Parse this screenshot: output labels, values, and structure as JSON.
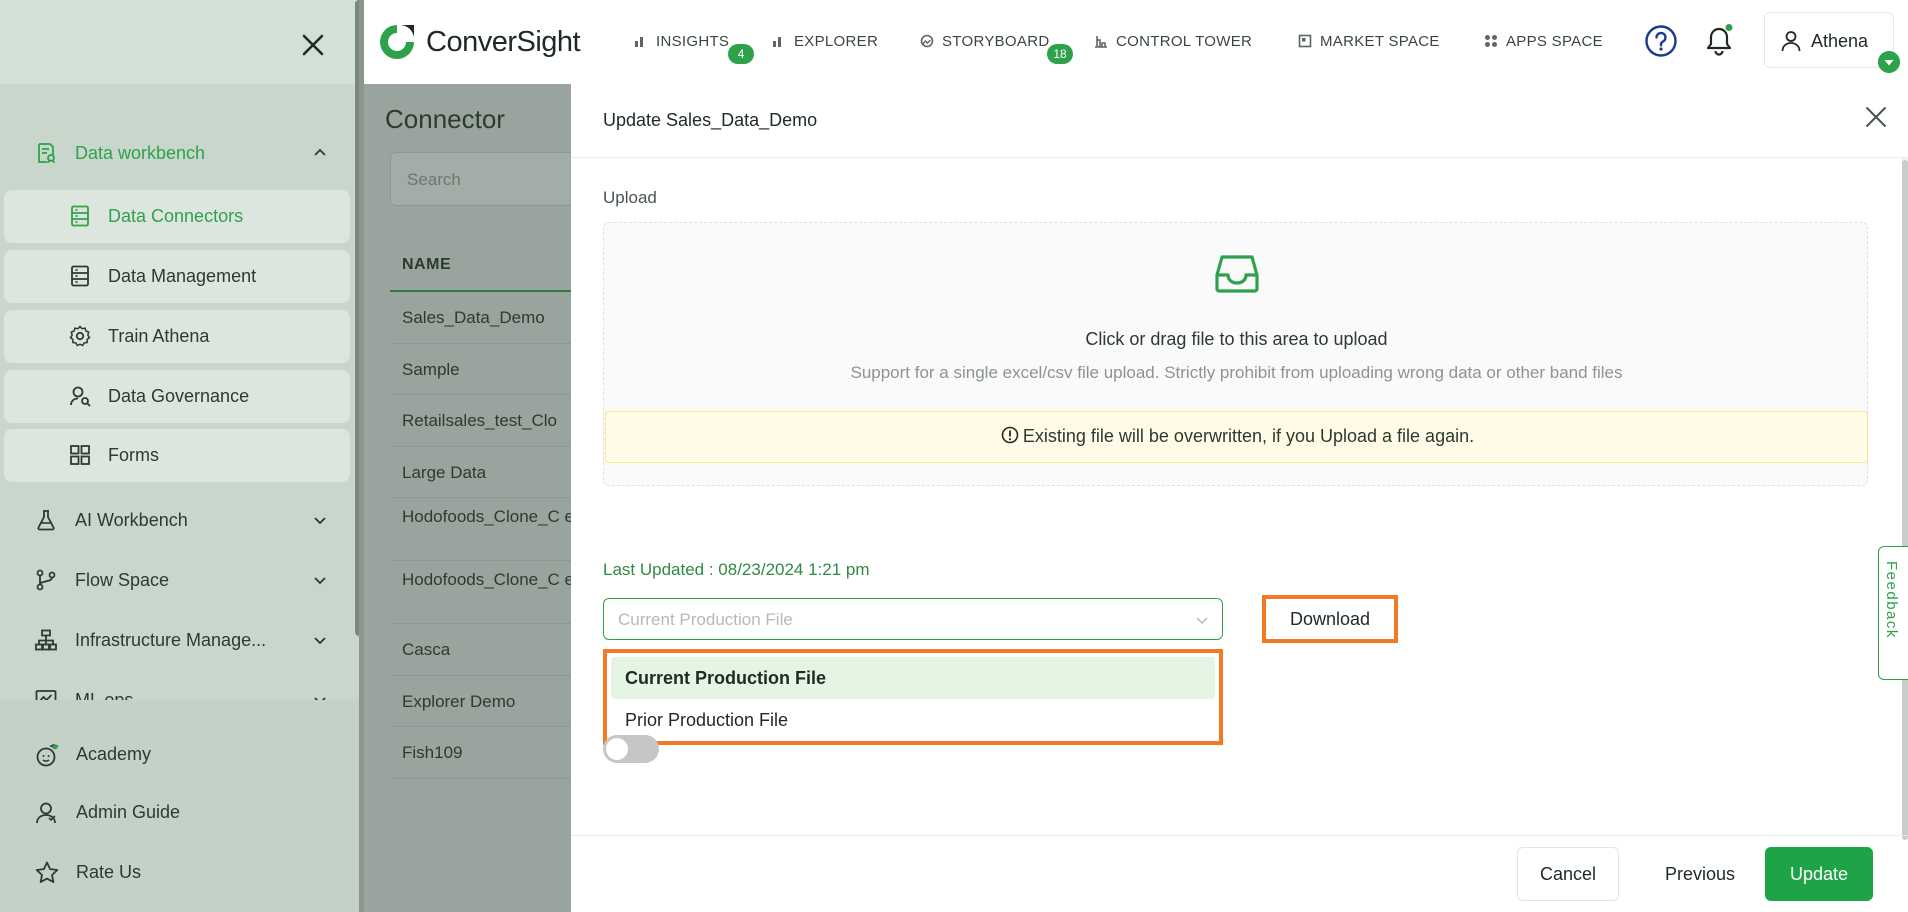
{
  "sidebar": {
    "groups": [
      {
        "label": "Data workbench",
        "icon": "report-icon",
        "expanded": true
      },
      {
        "label": "AI Workbench",
        "icon": "flask-icon"
      },
      {
        "label": "Flow Space",
        "icon": "branch-icon"
      },
      {
        "label": "Infrastructure Manage...",
        "icon": "hierarchy-icon"
      },
      {
        "label": "ML ops",
        "icon": "monitor-chart-icon"
      }
    ],
    "subitems": [
      {
        "label": "Data Connectors",
        "icon": "server-icon",
        "active": true
      },
      {
        "label": "Data Management",
        "icon": "server-icon"
      },
      {
        "label": "Train Athena",
        "icon": "gear-icon"
      },
      {
        "label": "Data Governance",
        "icon": "user-search-icon"
      },
      {
        "label": "Forms",
        "icon": "grid-icon"
      }
    ],
    "links": [
      {
        "label": "Academy",
        "icon": "academy-icon"
      },
      {
        "label": "Admin Guide",
        "icon": "user-guide-icon"
      },
      {
        "label": "Rate Us",
        "icon": "star-icon"
      }
    ]
  },
  "header": {
    "logo_text": "ConverSight",
    "nav": [
      {
        "label": "INSIGHTS",
        "icon": "bar-chart-icon",
        "badge": "4"
      },
      {
        "label": "EXPLORER",
        "icon": "bar-chart-icon"
      },
      {
        "label": "STORYBOARD",
        "icon": "storyboard-icon",
        "badge": "18"
      },
      {
        "label": "CONTROL TOWER",
        "icon": "tower-icon"
      },
      {
        "label": "MARKET SPACE",
        "icon": "market-icon"
      },
      {
        "label": "APPS SPACE",
        "icon": "apps-icon"
      }
    ],
    "user_name": "Athena"
  },
  "connectors": {
    "title": "Connector",
    "search_placeholder": "Search",
    "column_name": "NAME",
    "rows": [
      "Sales_Data_Demo",
      "Sample",
      "Retailsales_test_Clo",
      "Large Data",
      "Hodofoods_Clone_C e",
      "Hodofoods_Clone_C e",
      "Casca",
      "Explorer Demo",
      "Fish109"
    ]
  },
  "modal": {
    "title": "Update Sales_Data_Demo",
    "upload_label": "Upload",
    "dropzone_text": "Click or drag file to this area to upload",
    "dropzone_hint": "Support for a single excel/csv file upload. Strictly prohibit from uploading wrong data or other band files",
    "warning": "Existing file will be overwritten, if you Upload a file again.",
    "last_updated": "Last Updated : 08/23/2024 1:21 pm",
    "select_placeholder": "Current Production File",
    "download_label": "Download",
    "options": [
      "Current Production File",
      "Prior Production File"
    ],
    "cancel_label": "Cancel",
    "previous_label": "Previous",
    "update_label": "Update"
  },
  "feedback_label": "Feedback",
  "colors": {
    "accent": "#2ea24a",
    "highlight": "#f07b24",
    "warning_bg": "#fffbe6"
  }
}
